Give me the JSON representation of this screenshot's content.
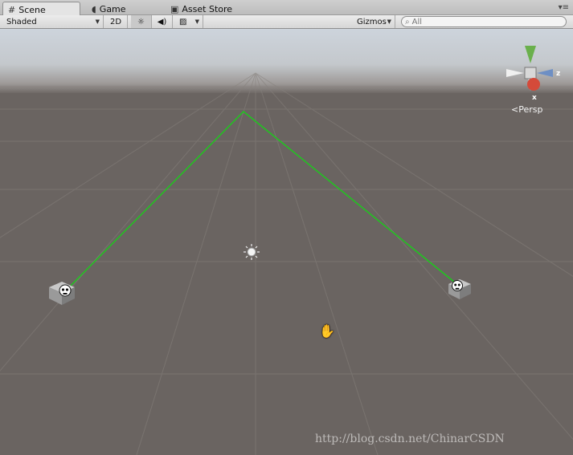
{
  "tabs": [
    {
      "label": "Scene",
      "icon": "grid-icon",
      "active": true
    },
    {
      "label": "Game",
      "icon": "pacman-icon",
      "active": false
    },
    {
      "label": "Asset Store",
      "icon": "bag-icon",
      "active": false
    }
  ],
  "toolbar": {
    "draw_mode": "Shaded",
    "mode_2d": "2D",
    "gizmos": "Gizmos",
    "search_placeholder": "All"
  },
  "scene": {
    "projection_label": "Persp",
    "gizmo_axes": {
      "x": "x",
      "z": "z"
    },
    "line_color": "#1ec81e"
  },
  "watermark": "http://blog.csdn.net/ChinarCSDN"
}
